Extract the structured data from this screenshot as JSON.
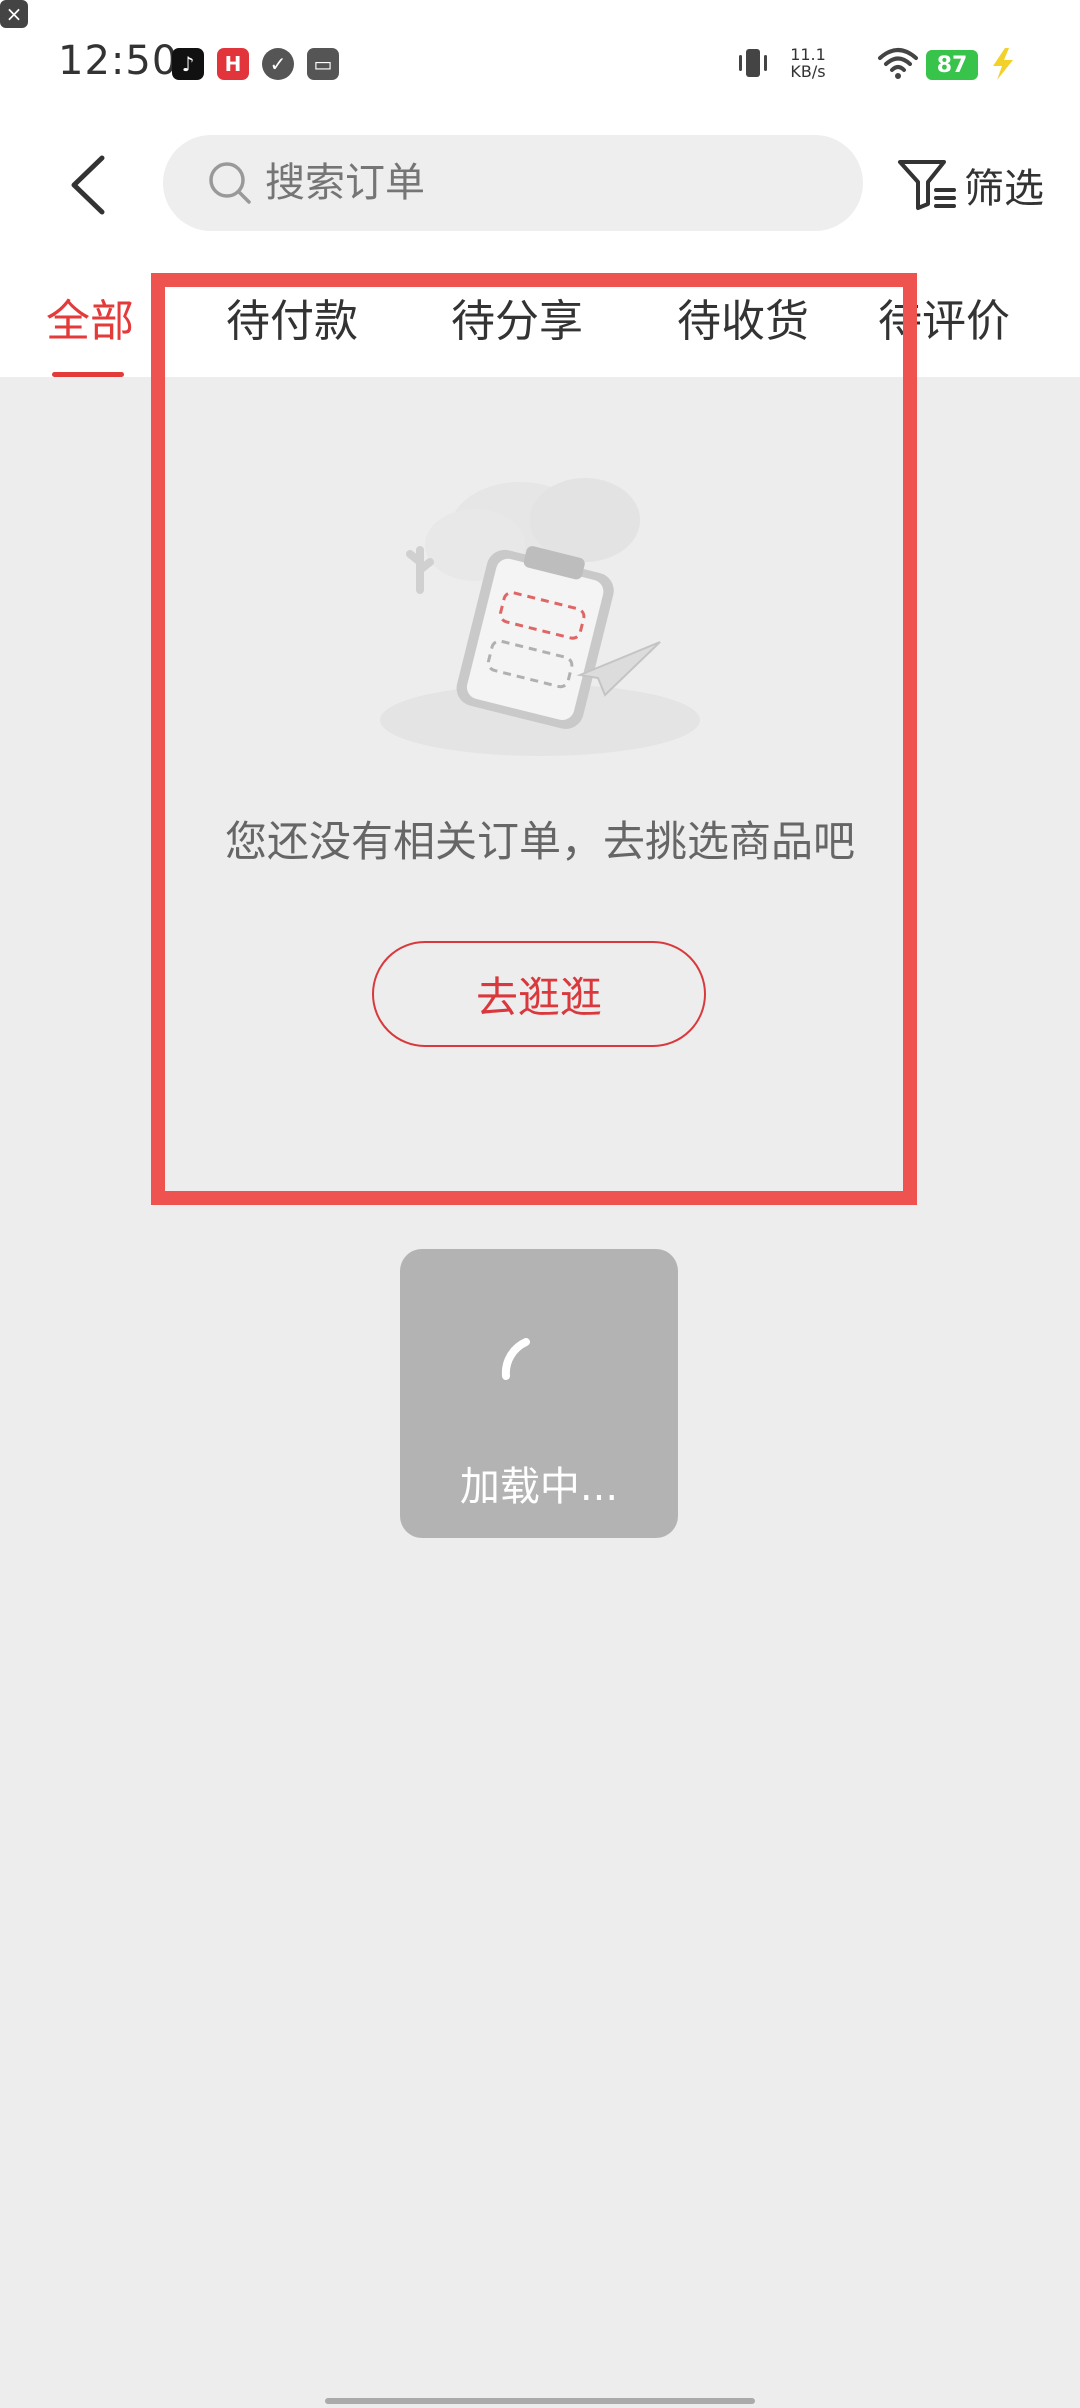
{
  "status_bar": {
    "time": "12:50",
    "net_speed_value": "11.1",
    "net_speed_unit": "KB/s",
    "battery": "87",
    "icons": [
      "tiktok-icon",
      "app-red-icon",
      "check-badge-icon",
      "bag-icon",
      "vibrate-icon",
      "sim-off-icon",
      "wifi-icon",
      "charging-icon"
    ]
  },
  "header": {
    "search_placeholder": "搜索订单",
    "filter_label": "筛选"
  },
  "tabs": [
    {
      "label": "全部",
      "active": true
    },
    {
      "label": "待付款",
      "active": false
    },
    {
      "label": "待分享",
      "active": false
    },
    {
      "label": "待收货",
      "active": false
    },
    {
      "label": "待评价",
      "active": false
    }
  ],
  "empty_state": {
    "message": "您还没有相关订单，去挑选商品吧",
    "button_label": "去逛逛"
  },
  "loading": {
    "text": "加载中..."
  },
  "colors": {
    "accent": "#e33a3a",
    "highlight_border": "#ef5350",
    "page_background": "#ededed",
    "battery": "#38c34a"
  }
}
